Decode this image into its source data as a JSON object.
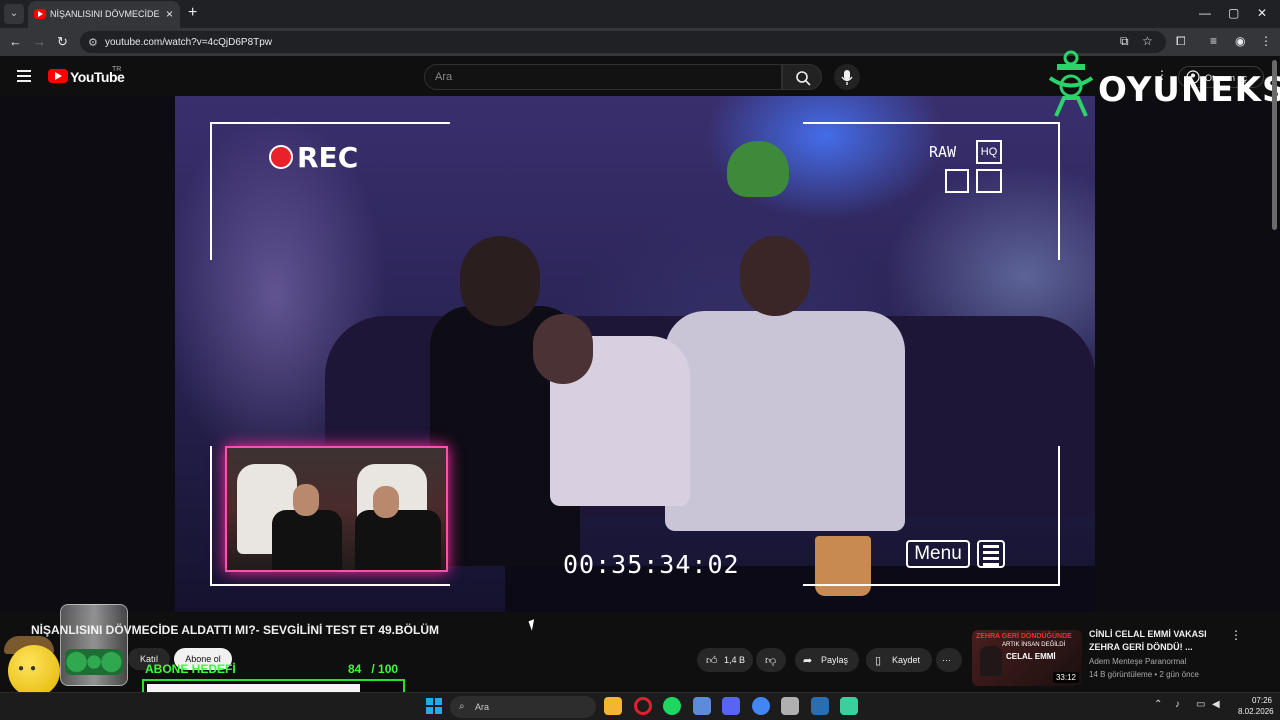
{
  "browser": {
    "tab_title": "NİŞANLISINI DÖVMECİDE ALDA",
    "tab_close": "×",
    "new_tab": "+",
    "url": "youtube.com/watch?v=4cQjD6P8Tpw",
    "window_controls": [
      "—",
      "▢",
      "✕"
    ]
  },
  "youtube": {
    "logo_text": "YouTube",
    "country_code": "TR",
    "search_placeholder": "Ara",
    "signin_label": "Oturum aç"
  },
  "overlay_brand": {
    "text": "OYUNEKS"
  },
  "video_overlay": {
    "rec_label": "REC",
    "raw_label": "RAW",
    "hq_label": "HQ",
    "timecode": "00:35:34:02",
    "menu_label": "Menu"
  },
  "video_info": {
    "title": "NİŞANLISINI DÖVMECİDE ALDATTI MI?- SEVGİLİNİ TEST ET 49.BÖLÜM",
    "join_label": "Katıl",
    "subscribe_label": "Abone ol",
    "like_count": "1,4 B",
    "share_label": "Paylaş",
    "save_label": "Kaydet",
    "more_label": "···"
  },
  "sub_goal": {
    "label": "ABONE HEDEFİ",
    "current": 84,
    "target": 100,
    "count_text": "84   / 100",
    "fill_fraction": 0.84
  },
  "recommendation": {
    "thumb_banner": "ZEHRA GERİ DÖNDÜĞÜNDE",
    "thumb_sub": "ARTIK İNSAN DEĞİLDİ",
    "thumb_name": "CELAL EMMİ",
    "duration": "33:12",
    "title": "CİNLİ CELAL EMMİ VAKASI ZEHRA GERİ DÖNDÜ! ...",
    "channel": "Adem Menteşe Paranormal",
    "meta": "14 B görüntüleme • 2 gün önce"
  },
  "taskbar": {
    "search_label": "Ara",
    "time": "07:26",
    "date": "8.02.2026",
    "apps": [
      {
        "name": "file-explorer",
        "color": "#f2b632"
      },
      {
        "name": "opera",
        "color": "#e0202e"
      },
      {
        "name": "spotify",
        "color": "#1ed760"
      },
      {
        "name": "network-app",
        "color": "#5b8bd9"
      },
      {
        "name": "discord",
        "color": "#5865f2"
      },
      {
        "name": "chrome",
        "color": "#4285f4"
      },
      {
        "name": "settings-app",
        "color": "#b0b0b0"
      },
      {
        "name": "steam",
        "color": "#2a6db0"
      },
      {
        "name": "media-app",
        "color": "#3ccf9e"
      }
    ]
  },
  "colors": {
    "accent_green": "#3aff3a",
    "youtube_red": "#ff0000",
    "rec_red": "#e8212b",
    "inset_pink": "#ff4fb0"
  }
}
